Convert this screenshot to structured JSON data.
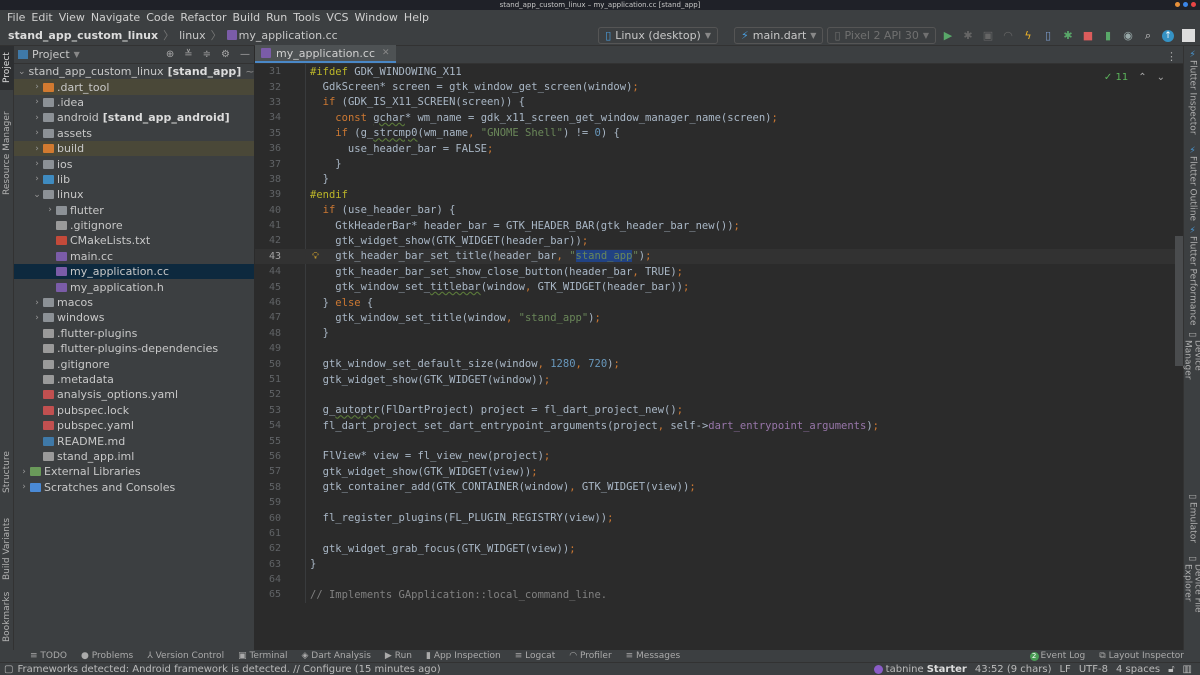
{
  "window": {
    "title": "stand_app_custom_linux – my_application.cc [stand_app]"
  },
  "menu": [
    "File",
    "Edit",
    "View",
    "Navigate",
    "Code",
    "Refactor",
    "Build",
    "Run",
    "Tools",
    "VCS",
    "Window",
    "Help"
  ],
  "breadcrumb": {
    "project": "stand_app_custom_linux",
    "folder": "linux",
    "file": "my_application.cc"
  },
  "toolbar": {
    "device": "Linux (desktop)",
    "config": "main.dart",
    "emulator": "Pixel 2 API 30",
    "icons": [
      "run-icon",
      "debug-icon",
      "attach-icon",
      "profile-icon",
      "hot-reload-icon",
      "device-icon",
      "debug-attach-icon",
      "stop-icon",
      "avd-manager-icon",
      "sdk-manager-icon",
      "search-icon",
      "update-icon",
      "avatar-icon"
    ]
  },
  "left_strip": {
    "project": "Project",
    "resource_manager": "Resource Manager",
    "structure": "Structure",
    "build_variants": "Build Variants",
    "bookmarks": "Bookmarks"
  },
  "right_strip": {
    "flutter_inspector": "Flutter Inspector",
    "flutter_outline": "Flutter Outline",
    "flutter_performance": "Flutter Performance",
    "device_manager": "Device Manager",
    "emulator": "Emulator",
    "device_file_explorer": "Device File Explorer"
  },
  "project_panel": {
    "title": "Project",
    "tree": [
      {
        "label": "stand_app_custom_linux",
        "bold": "[stand_app]",
        "suffix": "~/Flutte",
        "depth": 0,
        "arrow": "down",
        "icon": "flutter"
      },
      {
        "label": ".dart_tool",
        "depth": 1,
        "arrow": "right",
        "icon": "folder-orange",
        "tint": true
      },
      {
        "label": ".idea",
        "depth": 1,
        "arrow": "right",
        "icon": "folder"
      },
      {
        "label": "android",
        "bold": "[stand_app_android]",
        "depth": 1,
        "arrow": "right",
        "icon": "folder"
      },
      {
        "label": "assets",
        "depth": 1,
        "arrow": "right",
        "icon": "folder"
      },
      {
        "label": "build",
        "depth": 1,
        "arrow": "right",
        "icon": "folder-orange",
        "tint": true
      },
      {
        "label": "ios",
        "depth": 1,
        "arrow": "right",
        "icon": "folder"
      },
      {
        "label": "lib",
        "depth": 1,
        "arrow": "right",
        "icon": "folder-blue"
      },
      {
        "label": "linux",
        "depth": 1,
        "arrow": "down",
        "icon": "folder"
      },
      {
        "label": "flutter",
        "depth": 2,
        "arrow": "right",
        "icon": "folder"
      },
      {
        "label": ".gitignore",
        "depth": 2,
        "icon": "file"
      },
      {
        "label": "CMakeLists.txt",
        "depth": 2,
        "icon": "cmake"
      },
      {
        "label": "main.cc",
        "depth": 2,
        "icon": "cc"
      },
      {
        "label": "my_application.cc",
        "depth": 2,
        "icon": "cc",
        "selected": true
      },
      {
        "label": "my_application.h",
        "depth": 2,
        "icon": "cc"
      },
      {
        "label": "macos",
        "depth": 1,
        "arrow": "right",
        "icon": "folder"
      },
      {
        "label": "windows",
        "depth": 1,
        "arrow": "right",
        "icon": "folder"
      },
      {
        "label": ".flutter-plugins",
        "depth": 1,
        "icon": "file"
      },
      {
        "label": ".flutter-plugins-dependencies",
        "depth": 1,
        "icon": "file"
      },
      {
        "label": ".gitignore",
        "depth": 1,
        "icon": "file"
      },
      {
        "label": ".metadata",
        "depth": 1,
        "icon": "file"
      },
      {
        "label": "analysis_options.yaml",
        "depth": 1,
        "icon": "yaml"
      },
      {
        "label": "pubspec.lock",
        "depth": 1,
        "icon": "yaml"
      },
      {
        "label": "pubspec.yaml",
        "depth": 1,
        "icon": "yaml"
      },
      {
        "label": "README.md",
        "depth": 1,
        "icon": "md"
      },
      {
        "label": "stand_app.iml",
        "depth": 1,
        "icon": "file"
      },
      {
        "label": "External Libraries",
        "depth": 0,
        "arrow": "right",
        "icon": "libs"
      },
      {
        "label": "Scratches and Consoles",
        "depth": 0,
        "arrow": "right",
        "icon": "scratch"
      }
    ]
  },
  "editor": {
    "tab": "my_application.cc",
    "inspection_count": "11",
    "current_line": 43,
    "lines": [
      {
        "n": 31,
        "html": "<span class=\"pp\">#ifdef</span> GDK_WINDOWING_X11"
      },
      {
        "n": 32,
        "html": "  GdkScreen* screen = gtk_window_get_screen(window)<span class=\"kw\">;</span>"
      },
      {
        "n": 33,
        "html": "  <span class=\"kw\">if</span> (GDK_IS_X11_SCREEN(screen)) {"
      },
      {
        "n": 34,
        "html": "    <span class=\"kw\">const</span> <span class=\"uline\">gchar</span>* wm_name = gdk_x11_screen_get_window_manager_name(screen)<span class=\"kw\">;</span>"
      },
      {
        "n": 35,
        "html": "    <span class=\"kw\">if</span> (g_<span class=\"uline\">strcmp0</span>(wm_name<span class=\"kw\">,</span> <span class=\"str\">\"GNOME Shell\"</span>) != <span class=\"num\">0</span>) {"
      },
      {
        "n": 36,
        "html": "      use_header_bar = FALSE<span class=\"kw\">;</span>"
      },
      {
        "n": 37,
        "html": "    }"
      },
      {
        "n": 38,
        "html": "  }"
      },
      {
        "n": 39,
        "html": "<span class=\"pp\">#endif</span>"
      },
      {
        "n": 40,
        "html": "  <span class=\"kw\">if</span> (use_header_bar) {"
      },
      {
        "n": 41,
        "html": "    GtkHeaderBar* header_bar = GTK_HEADER_BAR(gtk_header_bar_new())<span class=\"kw\">;</span>"
      },
      {
        "n": 42,
        "html": "    gtk_widget_show(GTK_WIDGET(header_bar))<span class=\"kw\">;</span>"
      },
      {
        "n": 43,
        "html": "    gtk_header_bar_set_title(header_bar<span class=\"kw\">,</span> <span class=\"str\">\"<span class=\"sel-text\">stand_app</span>\"</span>)<span class=\"kw\">;</span>"
      },
      {
        "n": 44,
        "html": "    gtk_header_bar_set_show_close_button(header_bar<span class=\"kw\">,</span> TRUE)<span class=\"kw\">;</span>"
      },
      {
        "n": 45,
        "html": "    gtk_window_set_<span class=\"uline\">titlebar</span>(window<span class=\"kw\">,</span> GTK_WIDGET(header_bar))<span class=\"kw\">;</span>"
      },
      {
        "n": 46,
        "html": "  } <span class=\"kw\">else</span> {"
      },
      {
        "n": 47,
        "html": "    gtk_window_set_title(window<span class=\"kw\">,</span> <span class=\"str\">\"stand_app\"</span>)<span class=\"kw\">;</span>"
      },
      {
        "n": 48,
        "html": "  }"
      },
      {
        "n": 49,
        "html": ""
      },
      {
        "n": 50,
        "html": "  gtk_window_set_default_size(window<span class=\"kw\">,</span> <span class=\"num\">1280</span><span class=\"kw\">,</span> <span class=\"num\">720</span>)<span class=\"kw\">;</span>"
      },
      {
        "n": 51,
        "html": "  gtk_widget_show(GTK_WIDGET(window))<span class=\"kw\">;</span>"
      },
      {
        "n": 52,
        "html": ""
      },
      {
        "n": 53,
        "html": "  g_<span class=\"uline\">autoptr</span>(FlDartProject) project = fl_dart_project_new()<span class=\"kw\">;</span>"
      },
      {
        "n": 54,
        "html": "  fl_dart_project_set_dart_entrypoint_arguments(project<span class=\"kw\">,</span> self-><span class=\"fld\">dart_entrypoint_arguments</span>)<span class=\"kw\">;</span>"
      },
      {
        "n": 55,
        "html": ""
      },
      {
        "n": 56,
        "html": "  FlView* view = fl_view_new(project)<span class=\"kw\">;</span>"
      },
      {
        "n": 57,
        "html": "  gtk_widget_show(GTK_WIDGET(view))<span class=\"kw\">;</span>"
      },
      {
        "n": 58,
        "html": "  gtk_container_add(GTK_CONTAINER(window)<span class=\"kw\">,</span> GTK_WIDGET(view))<span class=\"kw\">;</span>"
      },
      {
        "n": 59,
        "html": ""
      },
      {
        "n": 60,
        "html": "  fl_register_plugins(FL_PLUGIN_REGISTRY(view))<span class=\"kw\">;</span>"
      },
      {
        "n": 61,
        "html": ""
      },
      {
        "n": 62,
        "html": "  gtk_widget_grab_focus(GTK_WIDGET(view))<span class=\"kw\">;</span>"
      },
      {
        "n": 63,
        "html": "}"
      },
      {
        "n": 64,
        "html": ""
      },
      {
        "n": 65,
        "html": "<span class=\"cmt\">// Implements GApplication::local_command_line.</span>"
      }
    ]
  },
  "bottom_tools": [
    "TODO",
    "Problems",
    "Version Control",
    "Terminal",
    "Dart Analysis",
    "Run",
    "App Inspection",
    "Logcat",
    "Profiler",
    "Messages"
  ],
  "bottom_right_tools": {
    "event_log": "Event Log",
    "event_count": "2",
    "layout_inspector": "Layout Inspector"
  },
  "status": {
    "message": "Frameworks detected: Android framework is detected. // Configure (15 minutes ago)",
    "tabnine": "tabnine",
    "tabnine_plan": "Starter",
    "position": "43:52 (9 chars)",
    "line_sep": "LF",
    "encoding": "UTF-8",
    "indent": "4 spaces"
  },
  "colors": {
    "accent": "#4a88c7",
    "selection": "#0d293e",
    "keyword": "#cc7832",
    "string": "#6a8759",
    "number": "#6897bb"
  }
}
